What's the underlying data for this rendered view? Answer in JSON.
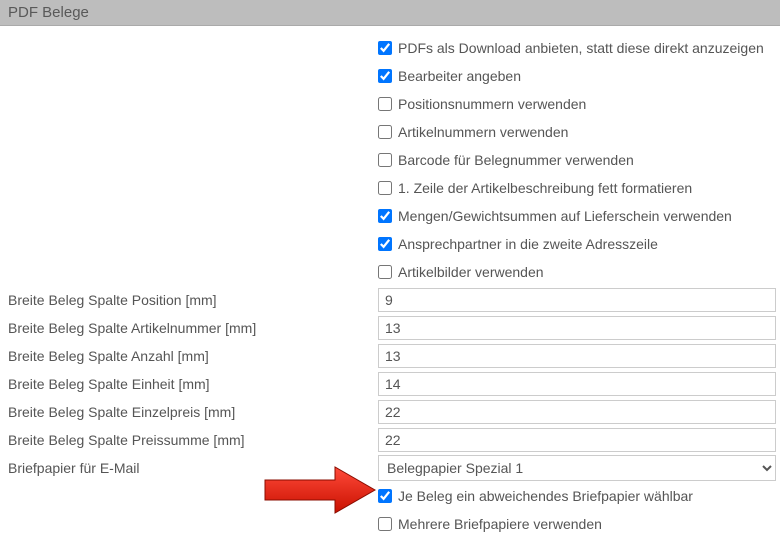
{
  "header": "PDF Belege",
  "checks": {
    "download": {
      "label": "PDFs als Download anbieten, statt diese direkt anzuzeigen",
      "checked": true
    },
    "bearbeiter": {
      "label": "Bearbeiter angeben",
      "checked": true
    },
    "posnr": {
      "label": "Positionsnummern verwenden",
      "checked": false
    },
    "artnr": {
      "label": "Artikelnummern verwenden",
      "checked": false
    },
    "barcode": {
      "label": "Barcode für Belegnummer verwenden",
      "checked": false
    },
    "firstline": {
      "label": "1. Zeile der Artikelbeschreibung fett formatieren",
      "checked": false
    },
    "mengen": {
      "label": "Mengen/Gewichtsummen auf Lieferschein verwenden",
      "checked": true
    },
    "ansprech": {
      "label": "Ansprechpartner in die zweite Adresszeile",
      "checked": true
    },
    "artbilder": {
      "label": "Artikelbilder verwenden",
      "checked": false
    },
    "jebeleg": {
      "label": "Je Beleg ein abweichendes Briefpapier wählbar",
      "checked": true
    },
    "mehrere": {
      "label": "Mehrere Briefpapiere verwenden",
      "checked": false
    }
  },
  "fields": {
    "position": {
      "label": "Breite Beleg Spalte Position [mm]",
      "value": "9"
    },
    "artikelnr": {
      "label": "Breite Beleg Spalte Artikelnummer [mm]",
      "value": "13"
    },
    "anzahl": {
      "label": "Breite Beleg Spalte Anzahl [mm]",
      "value": "13"
    },
    "einheit": {
      "label": "Breite Beleg Spalte Einheit [mm]",
      "value": "14"
    },
    "einzelpreis": {
      "label": "Breite Beleg Spalte Einzelpreis [mm]",
      "value": "22"
    },
    "preissumme": {
      "label": "Breite Beleg Spalte Preissumme [mm]",
      "value": "22"
    },
    "briefpapier": {
      "label": "Briefpapier für E-Mail",
      "value": "Belegpapier Spezial 1"
    }
  }
}
